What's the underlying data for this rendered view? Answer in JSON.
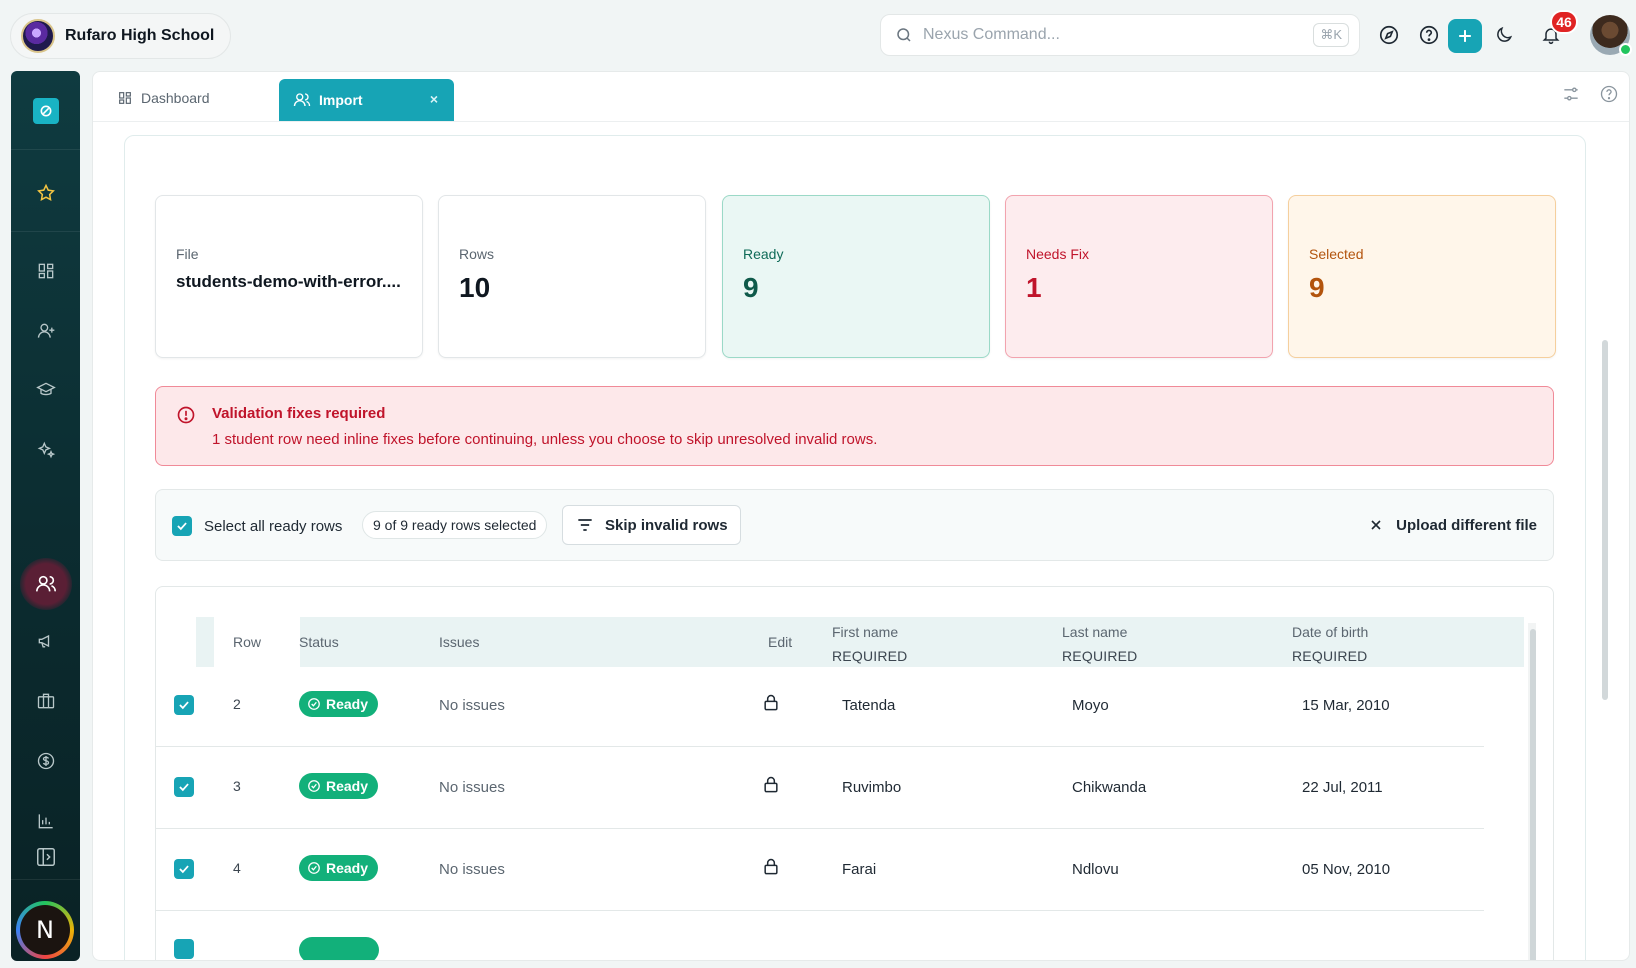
{
  "header": {
    "school_name": "Rufaro High School",
    "search_placeholder": "Nexus Command...",
    "search_shortcut": "⌘K",
    "notification_count": "46"
  },
  "sidebar": {
    "avatar_initial": "N",
    "items": [
      {
        "icon": "favorites-star-icon"
      },
      {
        "icon": "dashboard-grid-icon"
      },
      {
        "icon": "add-user-icon"
      },
      {
        "icon": "graduation-cap-icon"
      },
      {
        "icon": "sparkles-icon"
      },
      {
        "icon": "users-icon",
        "active": true
      },
      {
        "icon": "megaphone-icon"
      },
      {
        "icon": "briefcase-icon"
      },
      {
        "icon": "dollar-icon"
      },
      {
        "icon": "bar-chart-icon"
      }
    ]
  },
  "tabs": {
    "dashboard_label": "Dashboard",
    "import_label": "Import",
    "close_glyph": "×"
  },
  "stats": {
    "file": {
      "label": "File",
      "value": "students-demo-with-error...."
    },
    "rows": {
      "label": "Rows",
      "value": "10"
    },
    "ready": {
      "label": "Ready",
      "value": "9"
    },
    "needs_fix": {
      "label": "Needs Fix",
      "value": "1"
    },
    "selected": {
      "label": "Selected",
      "value": "9"
    }
  },
  "alert": {
    "title": "Validation fixes required",
    "message": "1 student row need inline fixes before continuing, unless you choose to skip unresolved invalid rows."
  },
  "toolbar": {
    "select_all_label": "Select all ready rows",
    "selection_count": "9 of 9 ready rows selected",
    "skip_label": "Skip invalid rows",
    "upload_label": "Upload different file"
  },
  "table": {
    "headers": {
      "row": "Row",
      "status": "Status",
      "issues": "Issues",
      "edit": "Edit",
      "first_name": "First name",
      "last_name": "Last name",
      "dob": "Date of birth",
      "required": "REQUIRED"
    },
    "rows": [
      {
        "row": "2",
        "status": "Ready",
        "issues": "No issues",
        "first_name": "Tatenda",
        "last_name": "Moyo",
        "dob": "15 Mar, 2010"
      },
      {
        "row": "3",
        "status": "Ready",
        "issues": "No issues",
        "first_name": "Ruvimbo",
        "last_name": "Chikwanda",
        "dob": "22 Jul, 2011"
      },
      {
        "row": "4",
        "status": "Ready",
        "issues": "No issues",
        "first_name": "Farai",
        "last_name": "Ndlovu",
        "dob": "05 Nov, 2010"
      }
    ]
  },
  "colors": {
    "accent": "#17a4b5",
    "sidebar": "#0f3b40",
    "ready_badge": "#12b07a",
    "error": "#c0142b",
    "warning": "#b3540d"
  }
}
